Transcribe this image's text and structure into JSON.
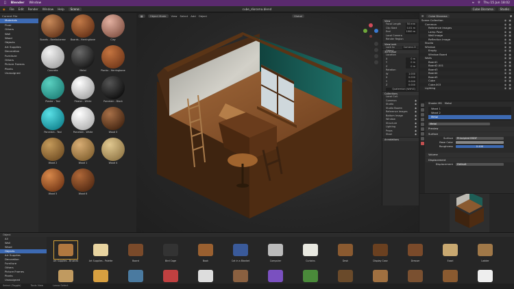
{
  "os_menubar": {
    "app": "Blender",
    "menu": "Window",
    "clock": "Thu 15 Jun  18:02"
  },
  "topbar": {
    "menus": [
      "File",
      "Edit",
      "Render",
      "Window",
      "Help"
    ],
    "workspace_tab": "Scene",
    "file_title": "cube_diorama.blend",
    "scene_label": "Cube Diorama",
    "layer_label": "Studio"
  },
  "asset_browser": {
    "library": "Current File",
    "tree": [
      {
        "label": "Materials",
        "selected": true
      },
      {
        "label": "Floor"
      },
      {
        "label": "Others"
      },
      {
        "label": "Wall"
      },
      {
        "label": "Wood"
      },
      {
        "label": "Objects"
      },
      {
        "label": "Art Supplies"
      },
      {
        "label": "Decoration"
      },
      {
        "label": "Furniture"
      },
      {
        "label": "Others"
      },
      {
        "label": "Picture Frames"
      },
      {
        "label": "Plants"
      },
      {
        "label": "Unassigned"
      }
    ],
    "materials": [
      {
        "label": "Boards - Bambolarese",
        "color_a": "#c88a5a",
        "color_b": "#5a2c14"
      },
      {
        "label": "Boards - Herringbone",
        "color_a": "#c27a48",
        "color_b": "#5c2a12"
      },
      {
        "label": "Clay",
        "color_a": "#e2b0a0",
        "color_b": "#7a4a3c"
      },
      {
        "label": "Concrete",
        "color_a": "#f2f2f2",
        "color_b": "#9a9a9a"
      },
      {
        "label": "Metal",
        "color_a": "#6a6a6a",
        "color_b": "#0c0c0c"
      },
      {
        "label": "Planks - Herringbone",
        "color_a": "#c47440",
        "color_b": "#6a3216"
      },
      {
        "label": "Plaster - Teal",
        "color_a": "#5ad0c0",
        "color_b": "#1a7a72"
      },
      {
        "label": "Plaster - White",
        "color_a": "#ffffff",
        "color_b": "#9a9a9a"
      },
      {
        "label": "Porcelain - Black",
        "color_a": "#555555",
        "color_b": "#050505"
      },
      {
        "label": "Porcelain - Teal",
        "color_a": "#5ae0e6",
        "color_b": "#0a7a86"
      },
      {
        "label": "Porcelain - White",
        "color_a": "#ffffff",
        "color_b": "#a8a8a8"
      },
      {
        "label": "Wood 3",
        "color_a": "#a87048",
        "color_b": "#3a1e0c"
      },
      {
        "label": "Wood 2",
        "color_a": "#c49a5a",
        "color_b": "#6a4820"
      },
      {
        "label": "Wood 1",
        "color_a": "#d8ad74",
        "color_b": "#7a5a2a"
      },
      {
        "label": "Wood 4",
        "color_a": "#e0c890",
        "color_b": "#8a7040"
      },
      {
        "label": "Wood 5",
        "color_a": "#d8884a",
        "color_b": "#6a3012"
      },
      {
        "label": "Wood 6",
        "color_a": "#b06838",
        "color_b": "#4a2410"
      }
    ]
  },
  "viewport": {
    "mode": "Object Mode",
    "view_menus": [
      "View",
      "Select",
      "Add",
      "Object"
    ],
    "transform": "Global"
  },
  "n_panel": {
    "view_title": "View",
    "focal_label": "Focal Length",
    "focal_value": "50 mm",
    "clip_start_label": "Clip Start",
    "clip_start_value": "0.01 m",
    "clip_end_label": "End",
    "clip_end_value": "1000 m",
    "local_camera": "Local Camera",
    "render_region": "Render Region",
    "view_lock": "View Lock",
    "lock_to_object": "Lock to Object",
    "lock_value": "Camera.Cl",
    "cursor_title": "3D Cursor",
    "location_label": "Location",
    "cursor_rows": [
      {
        "axis": "X",
        "value": "0 m"
      },
      {
        "axis": "Y",
        "value": "0 m"
      },
      {
        "axis": "Z",
        "value": "0 m"
      }
    ],
    "rotation_label": "Rotation",
    "rot_rows": [
      {
        "axis": "W",
        "value": "1.000"
      },
      {
        "axis": "X",
        "value": "0.000"
      },
      {
        "axis": "Y",
        "value": "0.000"
      },
      {
        "axis": "Z",
        "value": "0.000"
      }
    ],
    "rot_mode": "Quaternion (WXYZ)",
    "collections_title": "Collections",
    "local_coll": "Local Coll.",
    "collections": [
      "Common",
      "Studio",
      "Studio Bowen",
      "Reference Images",
      "Bottom Image",
      "Window",
      "Structure",
      "Lighting",
      "Props",
      "Stool"
    ],
    "annotations_title": "Annotations"
  },
  "outliner": {
    "scene": "Cube Diorama",
    "rows": [
      {
        "label": "Scene Collection",
        "indent": 0
      },
      {
        "label": "Common",
        "indent": 1
      },
      {
        "label": "Reference Images",
        "indent": 2
      },
      {
        "label": "Lamp Pose",
        "indent": 2
      },
      {
        "label": "Wall Image",
        "indent": 2
      },
      {
        "label": "Reflection Image",
        "indent": 2
      },
      {
        "label": "Studio",
        "indent": 1
      },
      {
        "label": "Window",
        "indent": 1
      },
      {
        "label": "Empty",
        "indent": 2
      },
      {
        "label": "Window Board",
        "indent": 2
      },
      {
        "label": "Walls",
        "indent": 1
      },
      {
        "label": "Board1",
        "indent": 2
      },
      {
        "label": "Board2.001",
        "indent": 2
      },
      {
        "label": "Board3",
        "indent": 2
      },
      {
        "label": "Board4",
        "indent": 2
      },
      {
        "label": "Board5",
        "indent": 2
      },
      {
        "label": "Cube",
        "indent": 2
      },
      {
        "label": "Cube.003",
        "indent": 2
      },
      {
        "label": "Lighting",
        "indent": 1
      }
    ]
  },
  "properties": {
    "object": "Shader MS",
    "material_name": "Metal",
    "slots": [
      "Wood 1",
      "Wood 2",
      "Metal"
    ],
    "sections": {
      "preview": "Preview",
      "surface": "Surface",
      "volume": "Volume",
      "displacement": "Displacement"
    },
    "surface_label": "Surface",
    "surface_value": "Principled BSDF",
    "base_color_label": "Base Color",
    "roughness_label": "Roughness",
    "roughness_value": "0.400",
    "displacement_label": "Displacement",
    "displacement_value": "Default"
  },
  "shelf": {
    "header": "Object",
    "tree": [
      {
        "label": "All"
      },
      {
        "label": "Wall"
      },
      {
        "label": "Wood"
      },
      {
        "label": "Objects",
        "selected": true
      },
      {
        "label": "Art Supplies"
      },
      {
        "label": "Decoration"
      },
      {
        "label": "Furniture"
      },
      {
        "label": "Others"
      },
      {
        "label": "Picture Frames"
      },
      {
        "label": "Plants"
      },
      {
        "label": "Unassigned"
      }
    ],
    "items": [
      {
        "label": "Art Supplies - Brushes",
        "icon": "brushes-icon"
      },
      {
        "label": "Art Supplies - Palette",
        "icon": "palette-icon"
      },
      {
        "label": "Board",
        "icon": "board-icon"
      },
      {
        "label": "Bird Cage",
        "icon": "birdcage-icon"
      },
      {
        "label": "Book",
        "icon": "book-icon"
      },
      {
        "label": "Cat in a Blanket",
        "icon": "cat-icon"
      },
      {
        "label": "Computer",
        "icon": "computer-icon"
      },
      {
        "label": "Curtains",
        "icon": "curtains-icon"
      },
      {
        "label": "Desk",
        "icon": "desk-icon"
      },
      {
        "label": "Display Case",
        "icon": "displaycase-icon"
      },
      {
        "label": "Dresser",
        "icon": "dresser-icon"
      },
      {
        "label": "Easel",
        "icon": "easel-icon"
      },
      {
        "label": "Ladder",
        "icon": "ladder-icon"
      },
      {
        "label": "",
        "icon": "frame-icon"
      },
      {
        "label": "",
        "icon": "painting-icon"
      },
      {
        "label": "",
        "icon": "painting2-icon"
      },
      {
        "label": "",
        "icon": "painting3-icon"
      },
      {
        "label": "",
        "icon": "canvas-icon"
      },
      {
        "label": "",
        "icon": "frame2-icon"
      },
      {
        "label": "",
        "icon": "flower-icon"
      },
      {
        "label": "",
        "icon": "plant-icon"
      },
      {
        "label": "",
        "icon": "rug-icon"
      },
      {
        "label": "",
        "icon": "bench-icon"
      },
      {
        "label": "",
        "icon": "stool-icon"
      },
      {
        "label": "",
        "icon": "table-icon"
      },
      {
        "label": "",
        "icon": "cup-icon"
      }
    ]
  },
  "status": {
    "items": [
      "Select (Toggle)",
      "Tools View",
      "Lasso Select"
    ]
  }
}
